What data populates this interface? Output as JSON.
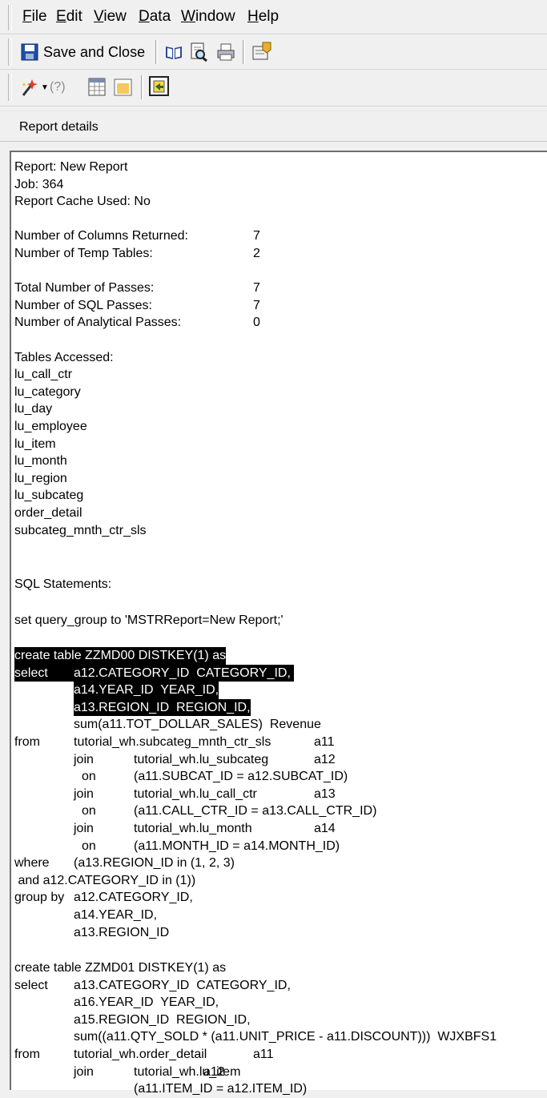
{
  "menu": [
    "File",
    "Edit",
    "View",
    "Data",
    "Window",
    "Help"
  ],
  "toolbar": {
    "save_label": "Save and Close"
  },
  "section_title": "Report details",
  "report": {
    "name": "Report: New Report",
    "job": "Job: 364",
    "cache": "Report Cache Used: No"
  },
  "stats": [
    {
      "label": "Number of Columns Returned:",
      "value": "7"
    },
    {
      "label": "Number of Temp Tables:",
      "value": "2"
    },
    {
      "label": "Total Number of Passes:",
      "value": "7"
    },
    {
      "label": "Number of SQL Passes:",
      "value": "7"
    },
    {
      "label": "Number of Analytical Passes:",
      "value": "0"
    }
  ],
  "tables_header": "Tables Accessed:",
  "tables": [
    "lu_call_ctr",
    "lu_category",
    "lu_day",
    "lu_employee",
    "lu_item",
    "lu_month",
    "lu_region",
    "lu_subcateg",
    "order_detail",
    "subcateg_mnth_ctr_sls"
  ],
  "sql_header": "SQL Statements:",
  "sql_set": "set query_group to 'MSTRReport=New Report;'",
  "sql1": [
    "create table ZZMD00 DISTKEY(1) as",
    "select",
    "a12.CATEGORY_ID  CATEGORY_ID,",
    "a14.YEAR_ID  YEAR_ID,",
    "a13.REGION_ID  REGION_ID,",
    "sum(a11.TOT_DOLLAR_SALES)  Revenue",
    "from",
    "tutorial_wh.subcateg_mnth_ctr_sls",
    "a11",
    "join",
    "tutorial_wh.lu_subcateg",
    "a12",
    "on",
    "(a11.SUBCAT_ID = a12.SUBCAT_ID)",
    "join",
    "tutorial_wh.lu_call_ctr",
    "a13",
    "on",
    "(a11.CALL_CTR_ID = a13.CALL_CTR_ID)",
    "join",
    "tutorial_wh.lu_month",
    "a14",
    "on",
    "(a11.MONTH_ID = a14.MONTH_ID)",
    "where",
    "(a13.REGION_ID in (1, 2, 3)",
    " and a12.CATEGORY_ID in (1))",
    "group by",
    "a12.CATEGORY_ID,",
    "a14.YEAR_ID,",
    "a13.REGION_ID"
  ],
  "sql2": [
    "create table ZZMD01 DISTKEY(1) as",
    "select",
    "a13.CATEGORY_ID  CATEGORY_ID,",
    "a16.YEAR_ID  YEAR_ID,",
    "a15.REGION_ID  REGION_ID,",
    "sum((a11.QTY_SOLD * (a11.UNIT_PRICE - a11.DISCOUNT)))  WJXBFS1",
    "from",
    "tutorial_wh.order_detail",
    "a11",
    "join",
    "tutorial_wh.lu_item",
    "a12",
    "(a11.ITEM_ID = a12.ITEM_ID)"
  ]
}
